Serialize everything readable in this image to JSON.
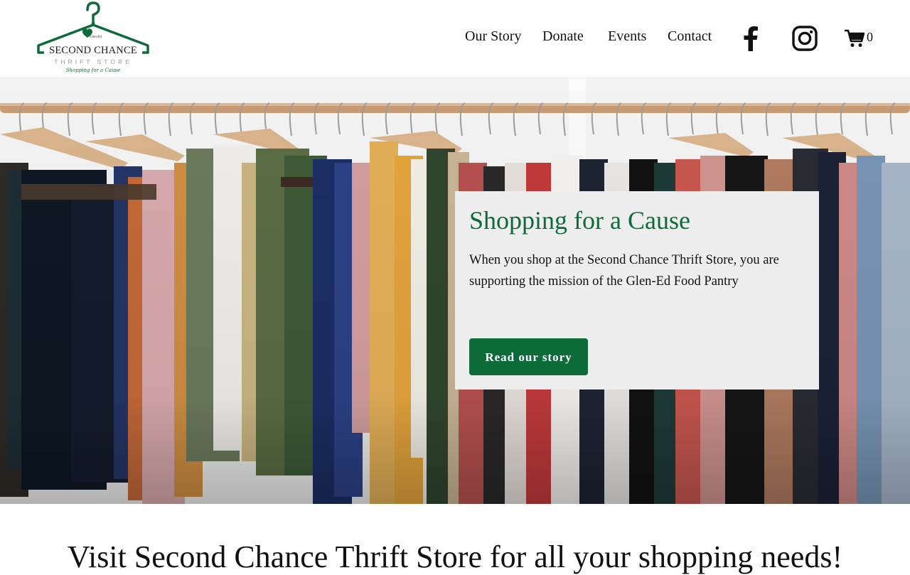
{
  "header": {
    "logo": {
      "name": "SECOND CHANCE",
      "subtitle": "THRIFT STORE",
      "tagline": "Shopping for a Cause",
      "small_text": "Glen-Ed",
      "brand_color": "#0d6b3a",
      "icon": "hanger-logo"
    },
    "nav": [
      {
        "label": "Our Story"
      },
      {
        "label": "Donate"
      },
      {
        "label": "Events"
      },
      {
        "label": "Contact"
      }
    ],
    "social": [
      {
        "icon": "facebook-icon"
      },
      {
        "icon": "instagram-icon"
      }
    ],
    "cart": {
      "icon": "cart-icon",
      "count": "0"
    }
  },
  "hero": {
    "image": "clothing-rack-photo",
    "card": {
      "title": "Shopping for a Cause",
      "text": "When you shop at the Second Chance Thrift Store, you are supporting the mission of the Glen-Ed Food Pantry",
      "button_label": "Read our story",
      "background": "#ededed",
      "title_color": "#0d6b3a"
    }
  },
  "section": {
    "heading": "Visit Second Chance Thrift Store for all your shopping needs!"
  }
}
